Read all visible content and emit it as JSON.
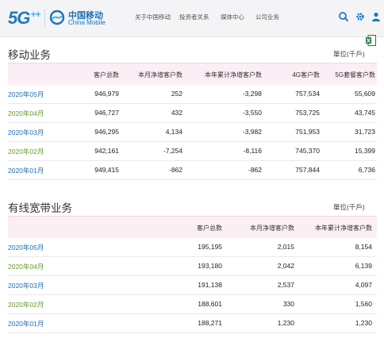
{
  "header": {
    "logo_text": "5G",
    "logo_plus": "++",
    "brand_cn": "中国移动",
    "brand_en": "China Mobile",
    "nav": [
      "关于中国移动",
      "投资者关系",
      "媒体中心",
      "公司业务"
    ],
    "icons": [
      "search-icon",
      "gear-icon",
      "user-icon"
    ],
    "accent": "#1e79bf"
  },
  "toolbar": {
    "excel_icon": "excel-icon",
    "excel_color": "#1e7b3e"
  },
  "mobile": {
    "title": "移动业务",
    "unit": "單位(千戶)",
    "columns": [
      "",
      "客户总数",
      "本月净增客户数",
      "本年累计净增客户数",
      "4G客户数",
      "5G套餐客户数"
    ],
    "rows": [
      {
        "date": "2020年05月",
        "total": "946,979",
        "month_net": "252",
        "ytd_net": "-3,298",
        "g4": "757,534",
        "g5": "55,609"
      },
      {
        "date": "2020年04月",
        "total": "946,727",
        "month_net": "432",
        "ytd_net": "-3,550",
        "g4": "753,725",
        "g5": "43,745"
      },
      {
        "date": "2020年03月",
        "total": "946,295",
        "month_net": "4,134",
        "ytd_net": "-3,982",
        "g4": "751,953",
        "g5": "31,723"
      },
      {
        "date": "2020年02月",
        "total": "942,161",
        "month_net": "-7,254",
        "ytd_net": "-8,116",
        "g4": "745,370",
        "g5": "15,399"
      },
      {
        "date": "2020年01月",
        "total": "949,415",
        "month_net": "-862",
        "ytd_net": "-862",
        "g4": "757,844",
        "g5": "6,736"
      }
    ]
  },
  "broadband": {
    "title": "有线宽带业务",
    "unit": "單位(千戶)",
    "columns": [
      "",
      "客户总数",
      "本月净增客户数",
      "本年累计净增客户数"
    ],
    "rows": [
      {
        "date": "2020年05月",
        "total": "195,195",
        "month_net": "2,015",
        "ytd_net": "8,154"
      },
      {
        "date": "2020年04月",
        "total": "193,180",
        "month_net": "2,042",
        "ytd_net": "6,139"
      },
      {
        "date": "2020年03月",
        "total": "191,138",
        "month_net": "2,537",
        "ytd_net": "4,097"
      },
      {
        "date": "2020年02月",
        "total": "188,601",
        "month_net": "330",
        "ytd_net": "1,560"
      },
      {
        "date": "2020年01月",
        "total": "188,271",
        "month_net": "1,230",
        "ytd_net": "1,230"
      }
    ]
  }
}
